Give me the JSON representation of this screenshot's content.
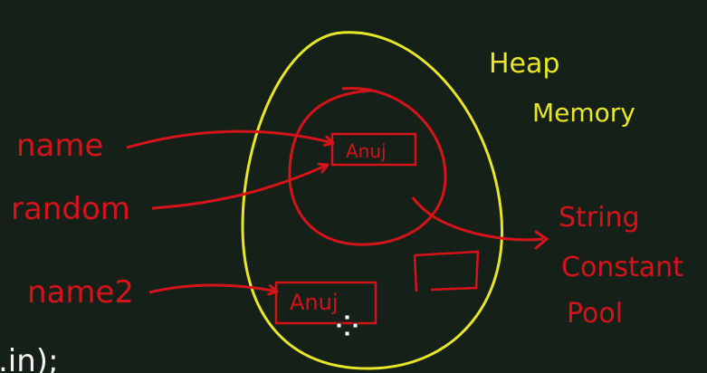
{
  "colors": {
    "background": "#152018",
    "heap": "#e8e628",
    "ink_red": "#d4141a",
    "ink_white": "#f2f2f2"
  },
  "heap": {
    "title_line1": "Heap",
    "title_line2": "Memory"
  },
  "pool": {
    "label_line1": "String",
    "label_line2": "Constant",
    "label_line3": "Pool"
  },
  "variables": {
    "name": "name",
    "random": "random",
    "name2": "name2"
  },
  "objects": {
    "pool_value": "Anuj",
    "heap_value": "Anuj"
  },
  "code_fragment": ".in);",
  "cursor": {
    "icon": "crosshair-cursor-icon"
  }
}
